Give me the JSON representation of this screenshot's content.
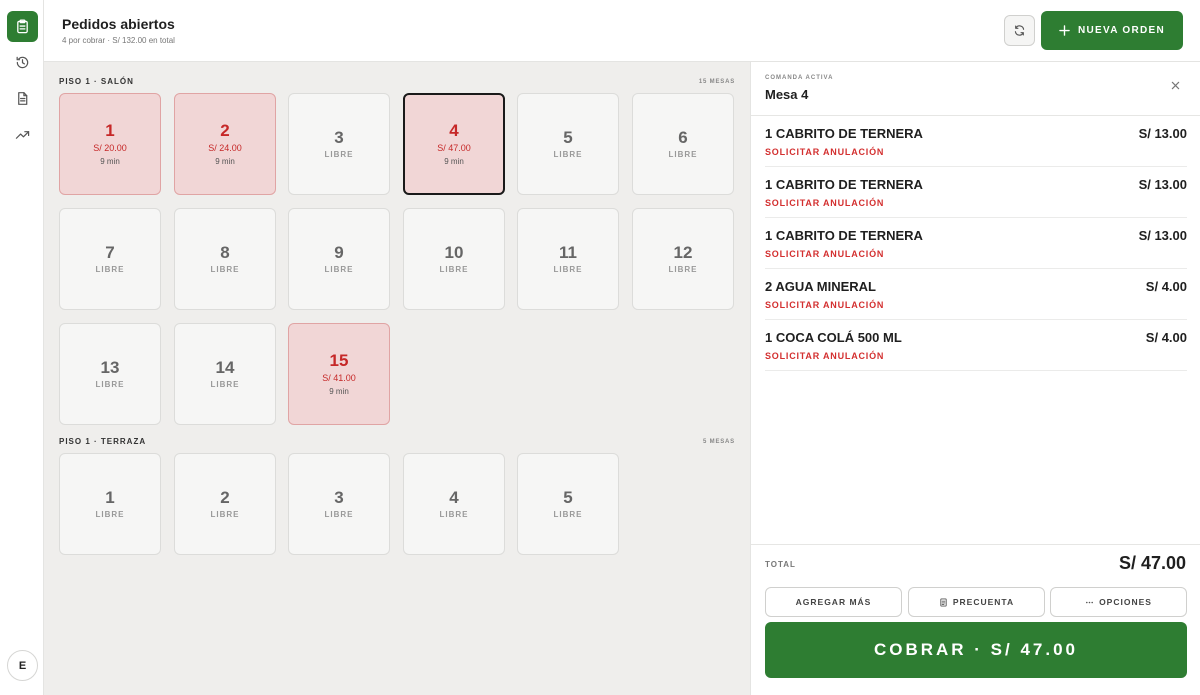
{
  "header": {
    "title": "Pedidos abiertos",
    "subtitle": "4 por cobrar · S/ 132.00 en total",
    "new_order_label": "NUEVA ORDEN"
  },
  "sidebar": {
    "items": [
      {
        "icon": "clipboard-icon",
        "active": true
      },
      {
        "icon": "history-icon",
        "active": false
      },
      {
        "icon": "document-icon",
        "active": false
      },
      {
        "icon": "trending-up-icon",
        "active": false
      }
    ],
    "avatar": "E"
  },
  "sections": [
    {
      "title": "PISO 1 · SALÓN",
      "count": "15 MESAS",
      "tables": [
        {
          "number": "1",
          "status": "occupied",
          "amount": "S/ 20.00",
          "time": "9 min"
        },
        {
          "number": "2",
          "status": "occupied",
          "amount": "S/ 24.00",
          "time": "9 min"
        },
        {
          "number": "3",
          "status": "free",
          "label": "LIBRE"
        },
        {
          "number": "4",
          "status": "occupied",
          "amount": "S/ 47.00",
          "time": "9 min",
          "selected": true
        },
        {
          "number": "5",
          "status": "free",
          "label": "LIBRE"
        },
        {
          "number": "6",
          "status": "free",
          "label": "LIBRE"
        },
        {
          "number": "7",
          "status": "free",
          "label": "LIBRE"
        },
        {
          "number": "8",
          "status": "free",
          "label": "LIBRE"
        },
        {
          "number": "9",
          "status": "free",
          "label": "LIBRE"
        },
        {
          "number": "10",
          "status": "free",
          "label": "LIBRE"
        },
        {
          "number": "11",
          "status": "free",
          "label": "LIBRE"
        },
        {
          "number": "12",
          "status": "free",
          "label": "LIBRE"
        },
        {
          "number": "13",
          "status": "free",
          "label": "LIBRE"
        },
        {
          "number": "14",
          "status": "free",
          "label": "LIBRE"
        },
        {
          "number": "15",
          "status": "occupied",
          "amount": "S/ 41.00",
          "time": "9 min"
        }
      ]
    },
    {
      "title": "PISO 1 · TERRAZA",
      "count": "5 MESAS",
      "tables": [
        {
          "number": "1",
          "status": "free",
          "label": "LIBRE"
        },
        {
          "number": "2",
          "status": "free",
          "label": "LIBRE"
        },
        {
          "number": "3",
          "status": "free",
          "label": "LIBRE"
        },
        {
          "number": "4",
          "status": "free",
          "label": "LIBRE"
        },
        {
          "number": "5",
          "status": "free",
          "label": "LIBRE"
        }
      ]
    }
  ],
  "panel": {
    "subtitle": "COMANDA ACTIVA",
    "title": "Mesa 4",
    "items": [
      {
        "name": "1 CABRITO DE TERNERA",
        "price": "S/ 13.00",
        "action": "SOLICITAR ANULACIÓN"
      },
      {
        "name": "1 CABRITO DE TERNERA",
        "price": "S/ 13.00",
        "action": "SOLICITAR ANULACIÓN"
      },
      {
        "name": "1 CABRITO DE TERNERA",
        "price": "S/ 13.00",
        "action": "SOLICITAR ANULACIÓN"
      },
      {
        "name": "2 AGUA MINERAL",
        "price": "S/ 4.00",
        "action": "SOLICITAR ANULACIÓN"
      },
      {
        "name": "1 COCA COLÁ 500 ML",
        "price": "S/ 4.00",
        "action": "SOLICITAR ANULACIÓN"
      }
    ],
    "total_label": "TOTAL",
    "total_value": "S/ 47.00",
    "add_more_label": "AGREGAR MÁS",
    "precuenta_label": "PRECUENTA",
    "options_label": "OPCIONES",
    "pay_label": "COBRAR · S/ 47.00"
  },
  "colors": {
    "accent": "#2e7d32",
    "occupied_bg": "#f1d6d6",
    "occupied_text": "#c62828",
    "void_text": "#d32f2f"
  }
}
